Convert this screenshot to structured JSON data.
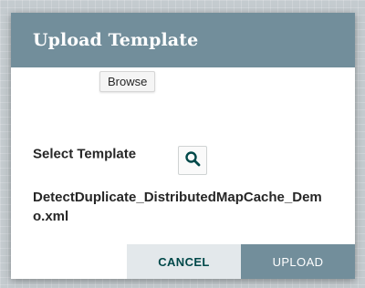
{
  "dialog": {
    "title": "Upload Template",
    "tooltip": "Browse",
    "field_label": "Select Template",
    "browse_icon": "search-icon",
    "selected_file": "DetectDuplicate_DistributedMapCache_Demo.xml",
    "cancel_label": "CANCEL",
    "upload_label": "UPLOAD"
  },
  "colors": {
    "header": "#728e9b",
    "cancel_bg": "#e3e8eb",
    "cancel_text": "#004849",
    "upload_bg": "#728e9b",
    "icon": "#004849"
  }
}
